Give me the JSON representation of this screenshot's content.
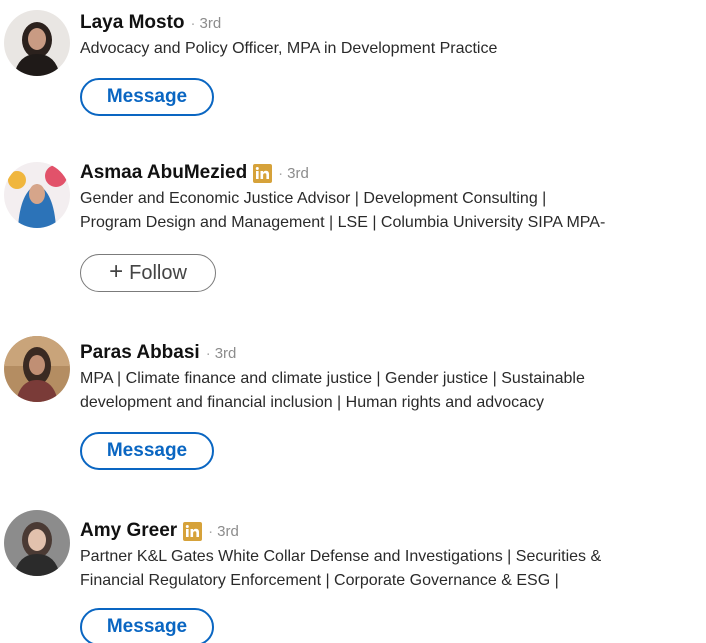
{
  "people": [
    {
      "name": "Laya Mosto",
      "separator": "·",
      "degree": "3rd",
      "premium": false,
      "headline": [
        "Advocacy and Policy Officer, MPA in Development Practice"
      ],
      "action": "Message"
    },
    {
      "name": "Asmaa AbuMezied",
      "separator": "·",
      "degree": "3rd",
      "premium": true,
      "headline": [
        "Gender and Economic Justice Advisor | Development Consulting |",
        "Program Design and Management | LSE | Columbia University SIPA MPA-"
      ],
      "action_plus": "+",
      "action": "Follow"
    },
    {
      "name": "Paras Abbasi",
      "separator": "·",
      "degree": "3rd",
      "premium": false,
      "headline": [
        "MPA | Climate finance and climate justice | Gender justice | Sustainable",
        "development and financial inclusion | Human rights and advocacy"
      ],
      "action": "Message"
    },
    {
      "name": "Amy Greer",
      "separator": "·",
      "degree": "3rd",
      "premium": true,
      "headline": [
        "Partner K&L Gates White Collar Defense and Investigations | Securities &",
        "Financial Regulatory Enforcement | Corporate Governance & ESG |"
      ],
      "action": "Message"
    }
  ],
  "colors": {
    "primary_blue": "#0a66c2",
    "premium_gold": "#d6a23a",
    "degree_gray": "#8c8c8c"
  },
  "icons": {
    "premium_badge": "linkedin-premium-icon",
    "follow_plus": "plus-icon"
  }
}
